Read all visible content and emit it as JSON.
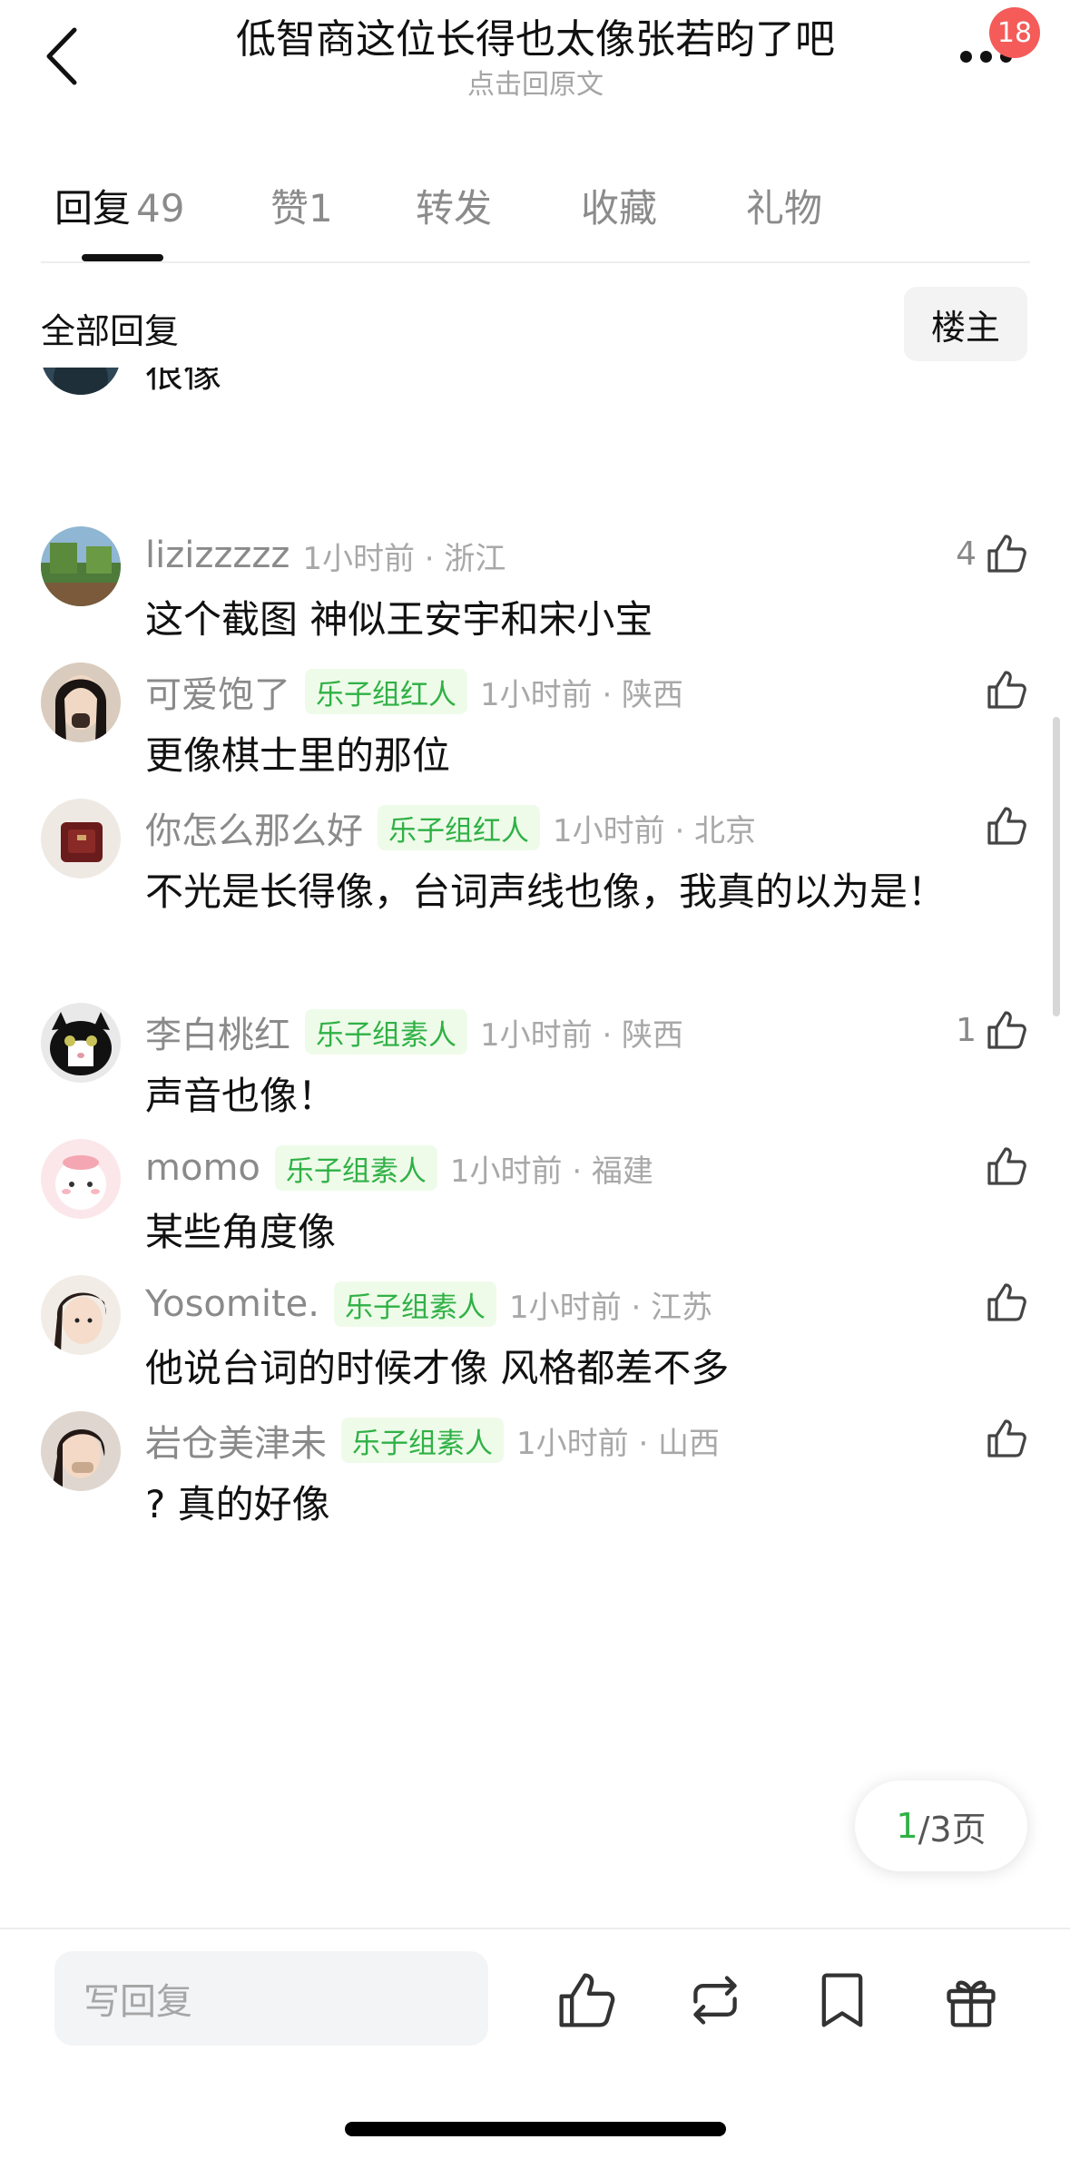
{
  "header": {
    "title": "低智商这位长得也太像张若昀了吧",
    "subtitle": "点击回原文",
    "badge": "18"
  },
  "tabs": [
    {
      "label": "回复",
      "count": "49",
      "active": true
    },
    {
      "label": "赞",
      "count": "1",
      "active": false
    },
    {
      "label": "转发",
      "count": "",
      "active": false
    },
    {
      "label": "收藏",
      "count": "",
      "active": false
    },
    {
      "label": "礼物",
      "count": "",
      "active": false
    }
  ],
  "filter": {
    "all_label": "全部回复",
    "owner_label": "楼主"
  },
  "comments": [
    {
      "user": "",
      "tag": "",
      "time": "",
      "text": "很像",
      "likes": ""
    },
    {
      "user": "lizizzzzz",
      "tag": "",
      "time": "1小时前 · 浙江",
      "text": "这个截图 神似王安宇和宋小宝",
      "likes": "4"
    },
    {
      "user": "可爱饱了",
      "tag": "乐子组红人",
      "time": "1小时前 · 陕西",
      "text": "更像棋士里的那位",
      "likes": ""
    },
    {
      "user": "你怎么那么好",
      "tag": "乐子组红人",
      "time": "1小时前 · 北京",
      "text": "不光是长得像，台词声线也像，我真的以为是！",
      "likes": ""
    },
    {
      "user": "李白桃红",
      "tag": "乐子组素人",
      "time": "1小时前 · 陕西",
      "text": "声音也像！",
      "likes": "1"
    },
    {
      "user": "momo",
      "tag": "乐子组素人",
      "time": "1小时前 · 福建",
      "text": "某些角度像",
      "likes": ""
    },
    {
      "user": "Yosomite.",
      "tag": "乐子组素人",
      "time": "1小时前 · 江苏",
      "text": "他说台词的时候才像  风格都差不多",
      "likes": ""
    },
    {
      "user": "岩仓美津未",
      "tag": "乐子组素人",
      "time": "1小时前 · 山西",
      "text": "? 真的好像",
      "likes": ""
    }
  ],
  "pager": {
    "current": "1",
    "rest": "/3页"
  },
  "bottom": {
    "reply_placeholder": "写回复"
  },
  "colors": {
    "accent_green": "#2fb145",
    "tag_bg": "#eefbe9",
    "badge_red": "#f45b59"
  }
}
